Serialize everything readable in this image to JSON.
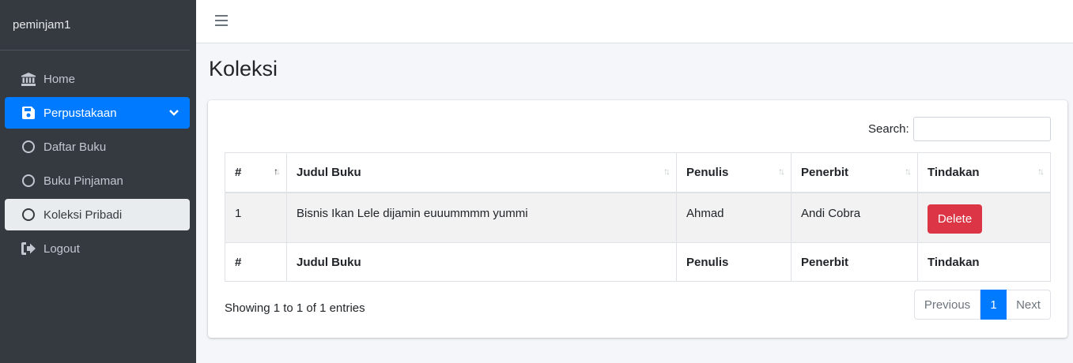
{
  "sidebar": {
    "brand": "peminjam1",
    "items": [
      {
        "label": "Home",
        "icon": "bank-icon"
      },
      {
        "label": "Perpustakaan",
        "icon": "save-icon"
      },
      {
        "label": "Daftar Buku",
        "icon": "circle-icon"
      },
      {
        "label": "Buku Pinjaman",
        "icon": "circle-icon"
      },
      {
        "label": "Koleksi Pribadi",
        "icon": "circle-icon"
      },
      {
        "label": "Logout",
        "icon": "sign-out-icon"
      }
    ]
  },
  "page": {
    "title": "Koleksi"
  },
  "search": {
    "label": "Search:",
    "value": ""
  },
  "table": {
    "headers": [
      "#",
      "Judul Buku",
      "Penulis",
      "Penerbit",
      "Tindakan"
    ],
    "rows": [
      {
        "no": "1",
        "judul": "Bisnis Ikan Lele dijamin euuummmm yummi",
        "penulis": "Ahmad",
        "penerbit": "Andi Cobra",
        "action": "Delete"
      }
    ],
    "footers": [
      "#",
      "Judul Buku",
      "Penulis",
      "Penerbit",
      "Tindakan"
    ]
  },
  "info": "Showing 1 to 1 of 1 entries",
  "pagination": {
    "previous": "Previous",
    "current": "1",
    "next": "Next"
  },
  "colors": {
    "sidebar": "#343a40",
    "primary": "#007bff",
    "danger": "#dc3545",
    "background": "#f4f6f9"
  }
}
